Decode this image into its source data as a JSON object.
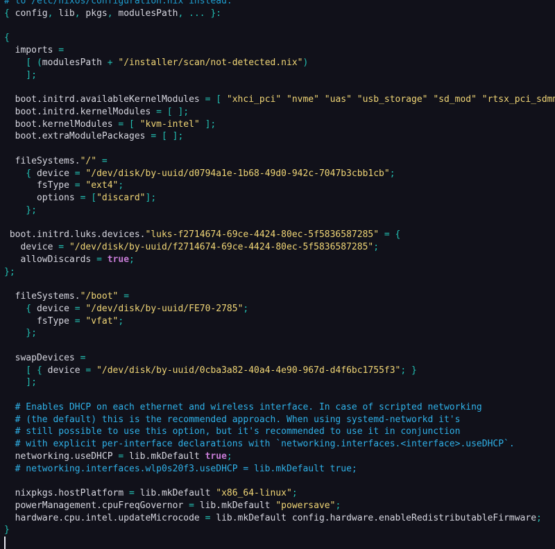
{
  "editor": {
    "colors": {
      "background": "#11111a",
      "text": "#d7d7e0",
      "punctuation": "#22c1b4",
      "string": "#f1d676",
      "boolean": "#c77cd6",
      "comment": "#2fb1e8"
    },
    "lines": [
      [
        [
          "dim",
          "# to /etc/nixos/configuration.nix instead."
        ]
      ],
      [
        [
          "punc",
          "{ "
        ],
        [
          "key",
          "config"
        ],
        [
          "punc",
          ", "
        ],
        [
          "key",
          "lib"
        ],
        [
          "punc",
          ", "
        ],
        [
          "key",
          "pkgs"
        ],
        [
          "punc",
          ", "
        ],
        [
          "key",
          "modulesPath"
        ],
        [
          "punc",
          ", ... }:"
        ]
      ],
      [],
      [
        [
          "punc",
          "{"
        ]
      ],
      [
        [
          "key",
          "  imports "
        ],
        [
          "punc",
          "="
        ]
      ],
      [
        [
          "punc",
          "    [ ("
        ],
        [
          "key",
          "modulesPath "
        ],
        [
          "punc",
          "+ "
        ],
        [
          "str",
          "\"/installer/scan/not-detected.nix\""
        ],
        [
          "punc",
          ")"
        ]
      ],
      [
        [
          "punc",
          "    ];"
        ]
      ],
      [],
      [
        [
          "key",
          "  boot.initrd.availableKernelModules "
        ],
        [
          "punc",
          "= [ "
        ],
        [
          "str",
          "\"xhci_pci\" \"nvme\" \"uas\" \"usb_storage\" \"sd_mod\" \"rtsx_pci_sdmmc\""
        ],
        [
          "punc",
          " ];"
        ]
      ],
      [
        [
          "key",
          "  boot.initrd.kernelModules "
        ],
        [
          "punc",
          "= [ ];"
        ]
      ],
      [
        [
          "key",
          "  boot.kernelModules "
        ],
        [
          "punc",
          "= [ "
        ],
        [
          "str",
          "\"kvm-intel\""
        ],
        [
          "punc",
          " ];"
        ]
      ],
      [
        [
          "key",
          "  boot.extraModulePackages "
        ],
        [
          "punc",
          "= [ ];"
        ]
      ],
      [],
      [
        [
          "key",
          "  fileSystems."
        ],
        [
          "str",
          "\"/\""
        ],
        [
          "punc",
          " ="
        ]
      ],
      [
        [
          "punc",
          "    { "
        ],
        [
          "key",
          "device "
        ],
        [
          "punc",
          "= "
        ],
        [
          "str",
          "\"/dev/disk/by-uuid/d0794a1e-1b68-49d0-942c-7047b3cbb1cb\""
        ],
        [
          "punc",
          ";"
        ]
      ],
      [
        [
          "key",
          "      fsType "
        ],
        [
          "punc",
          "= "
        ],
        [
          "str",
          "\"ext4\""
        ],
        [
          "punc",
          ";"
        ]
      ],
      [
        [
          "key",
          "      options "
        ],
        [
          "punc",
          "= ["
        ],
        [
          "str",
          "\"discard\""
        ],
        [
          "punc",
          "];"
        ]
      ],
      [
        [
          "punc",
          "    };"
        ]
      ],
      [],
      [
        [
          "key",
          " boot.initrd.luks.devices."
        ],
        [
          "str",
          "\"luks-f2714674-69ce-4424-80ec-5f5836587285\""
        ],
        [
          "punc",
          " = {"
        ]
      ],
      [
        [
          "key",
          "   device "
        ],
        [
          "punc",
          "= "
        ],
        [
          "str",
          "\"/dev/disk/by-uuid/f2714674-69ce-4424-80ec-5f5836587285\""
        ],
        [
          "punc",
          ";"
        ]
      ],
      [
        [
          "key",
          "   allowDiscards "
        ],
        [
          "punc",
          "= "
        ],
        [
          "bool",
          "true"
        ],
        [
          "punc",
          ";"
        ]
      ],
      [
        [
          "punc",
          "};"
        ]
      ],
      [],
      [
        [
          "key",
          "  fileSystems."
        ],
        [
          "str",
          "\"/boot\""
        ],
        [
          "punc",
          " ="
        ]
      ],
      [
        [
          "punc",
          "    { "
        ],
        [
          "key",
          "device "
        ],
        [
          "punc",
          "= "
        ],
        [
          "str",
          "\"/dev/disk/by-uuid/FE70-2785\""
        ],
        [
          "punc",
          ";"
        ]
      ],
      [
        [
          "key",
          "      fsType "
        ],
        [
          "punc",
          "= "
        ],
        [
          "str",
          "\"vfat\""
        ],
        [
          "punc",
          ";"
        ]
      ],
      [
        [
          "punc",
          "    };"
        ]
      ],
      [],
      [
        [
          "key",
          "  swapDevices "
        ],
        [
          "punc",
          "="
        ]
      ],
      [
        [
          "punc",
          "    [ { "
        ],
        [
          "key",
          "device "
        ],
        [
          "punc",
          "= "
        ],
        [
          "str",
          "\"/dev/disk/by-uuid/0cba3a82-40a4-4e90-967d-d4f6bc1755f3\""
        ],
        [
          "punc",
          "; }"
        ]
      ],
      [
        [
          "punc",
          "    ];"
        ]
      ],
      [],
      [
        [
          "cmt",
          "  # Enables DHCP on each ethernet and wireless interface. In case of scripted networking"
        ]
      ],
      [
        [
          "cmt",
          "  # (the default) this is the recommended approach. When using systemd-networkd it's"
        ]
      ],
      [
        [
          "cmt",
          "  # still possible to use this option, but it's recommended to use it in conjunction"
        ]
      ],
      [
        [
          "cmt",
          "  # with explicit per-interface declarations with `networking.interfaces.<interface>.useDHCP`."
        ]
      ],
      [
        [
          "key",
          "  networking.useDHCP "
        ],
        [
          "punc",
          "= "
        ],
        [
          "plain",
          "lib.mkDefault "
        ],
        [
          "bool",
          "true"
        ],
        [
          "punc",
          ";"
        ]
      ],
      [
        [
          "cmt",
          "  # networking.interfaces.wlp0s20f3.useDHCP = lib.mkDefault true;"
        ]
      ],
      [],
      [
        [
          "key",
          "  nixpkgs.hostPlatform "
        ],
        [
          "punc",
          "= "
        ],
        [
          "plain",
          "lib.mkDefault "
        ],
        [
          "str",
          "\"x86_64-linux\""
        ],
        [
          "punc",
          ";"
        ]
      ],
      [
        [
          "key",
          "  powerManagement.cpuFreqGovernor "
        ],
        [
          "punc",
          "= "
        ],
        [
          "plain",
          "lib.mkDefault "
        ],
        [
          "str",
          "\"powersave\""
        ],
        [
          "punc",
          ";"
        ]
      ],
      [
        [
          "key",
          "  hardware.cpu.intel.updateMicrocode "
        ],
        [
          "punc",
          "= "
        ],
        [
          "plain",
          "lib.mkDefault config.hardware.enableRedistributableFirmware"
        ],
        [
          "punc",
          ";"
        ]
      ],
      [
        [
          "punc",
          "}"
        ]
      ]
    ]
  }
}
